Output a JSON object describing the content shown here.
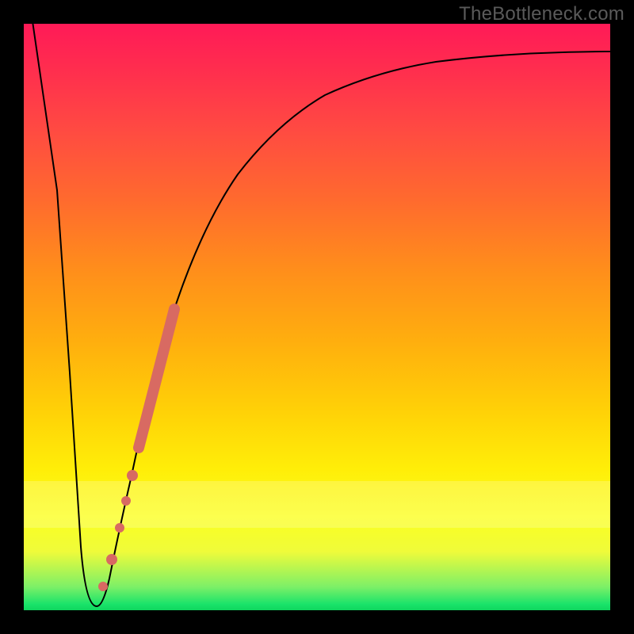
{
  "watermark": "TheBottleneck.com",
  "colors": {
    "frame": "#000000",
    "watermark_text": "#5a5a5a",
    "curve": "#000000",
    "marker": "#d86a62",
    "gradient_top": "#ff1a57",
    "gradient_mid": "#ffd107",
    "gradient_bottom": "#19e36a"
  },
  "chart_data": {
    "type": "line",
    "title": "",
    "xlabel": "",
    "ylabel": "",
    "xlim": [
      0,
      100
    ],
    "ylim": [
      0,
      100
    ],
    "grid": false,
    "legend": false,
    "x": [
      0,
      3,
      4.5,
      6,
      7.5,
      9,
      10.5,
      12,
      14,
      16,
      18,
      20,
      22,
      25,
      28,
      32,
      36,
      40,
      45,
      50,
      55,
      60,
      65,
      70,
      75,
      80,
      85,
      90,
      95,
      100
    ],
    "y": [
      100,
      70,
      40,
      10,
      2,
      1,
      1,
      2,
      6,
      14,
      24,
      34,
      42,
      52,
      60,
      68,
      74,
      78.5,
      82.5,
      85.5,
      87.8,
      89.5,
      90.7,
      91.6,
      92.3,
      92.9,
      93.3,
      93.6,
      93.8,
      94
    ],
    "markers": {
      "thick_segment": {
        "x_start": 18.5,
        "x_end": 23.5,
        "y_start": 27,
        "y_end": 47
      },
      "dots": [
        {
          "x": 17.5,
          "y": 22
        },
        {
          "x": 16.5,
          "y": 17.5
        },
        {
          "x": 15.5,
          "y": 13
        },
        {
          "x": 14.0,
          "y": 7.5
        },
        {
          "x": 12.5,
          "y": 3.5
        }
      ]
    },
    "annotations": []
  }
}
